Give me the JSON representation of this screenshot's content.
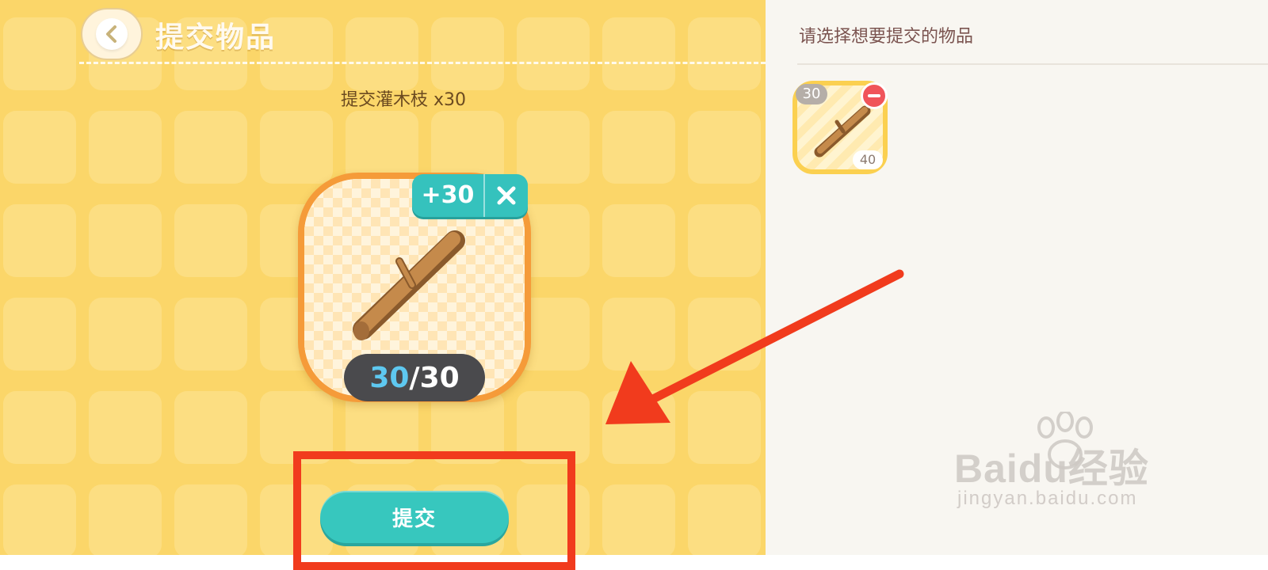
{
  "header": {
    "back_icon": "chevron-left-icon",
    "title": "提交物品"
  },
  "request": {
    "label": "提交灌木枝 x30"
  },
  "item_card": {
    "item_icon": "branch-icon",
    "add_amount": "+30",
    "close_icon": "close-icon",
    "count_current": "30",
    "count_separator": "/",
    "count_required": "30"
  },
  "actions": {
    "submit_label": "提交"
  },
  "side_panel": {
    "title": "请选择想要提交的物品",
    "slots": [
      {
        "item_icon": "branch-icon",
        "selected_count": "30",
        "stock": "40",
        "remove_icon": "minus-icon"
      }
    ]
  },
  "annotations": {
    "highlight_color": "#f13b1d",
    "arrow_color": "#f13b1d"
  },
  "watermark": {
    "brand": "Baidu经验",
    "url": "jingyan.baidu.com"
  },
  "colors": {
    "left_bg": "#fbd669",
    "right_bg": "#f8f6f1",
    "teal": "#37c7be",
    "orange_border": "#f59b39",
    "count_highlight": "#5ec8f0"
  }
}
